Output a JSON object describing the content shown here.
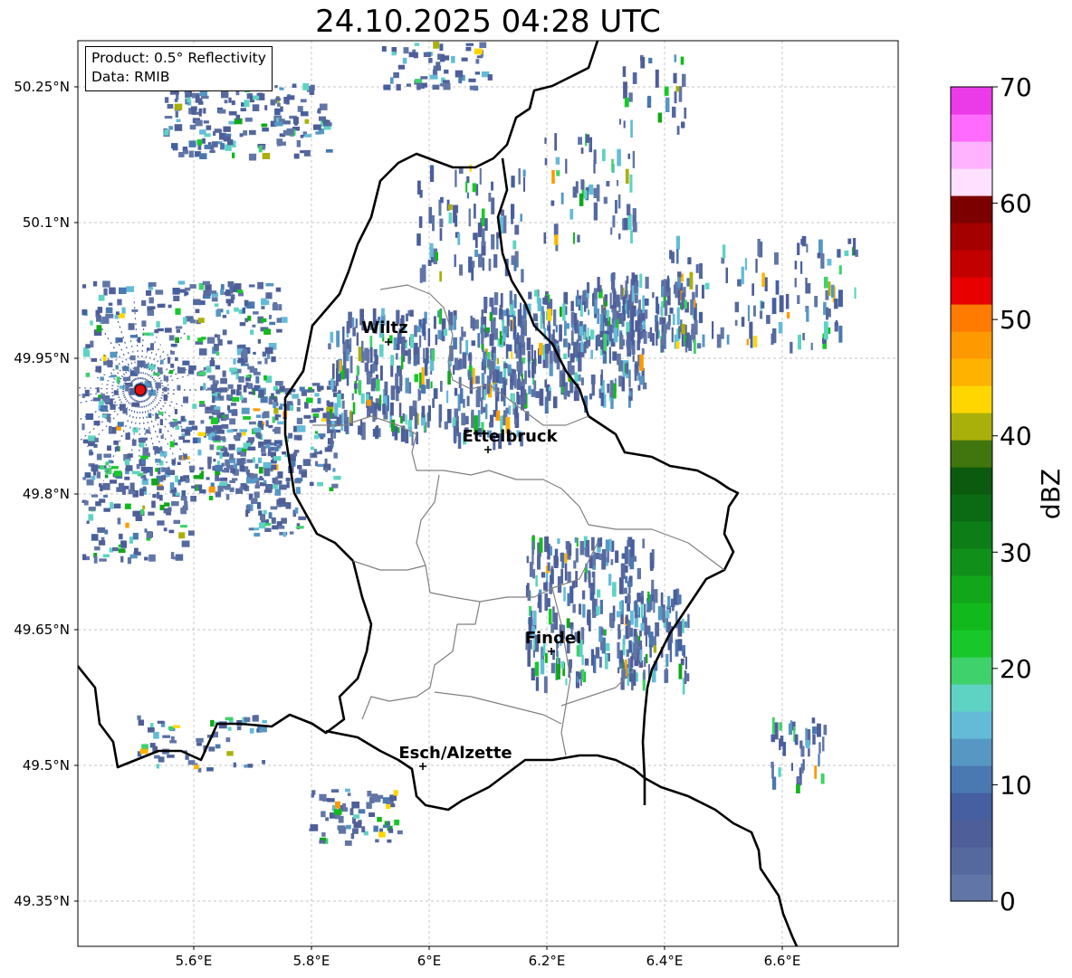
{
  "title": "24.10.2025 04:28 UTC",
  "info": {
    "product": "Product: 0.5° Reflectivity",
    "data": "Data: RMIB"
  },
  "axes": {
    "lon_ticks": [
      "5.6°E",
      "5.8°E",
      "6°E",
      "6.2°E",
      "6.4°E",
      "6.6°E"
    ],
    "lat_ticks": [
      "50.25°N",
      "50.1°N",
      "49.95°N",
      "49.8°N",
      "49.65°N",
      "49.5°N",
      "49.35°N"
    ]
  },
  "cities": [
    {
      "name": "Wiltz"
    },
    {
      "name": "Ettelbruck"
    },
    {
      "name": "Findel"
    },
    {
      "name": "Esch/Alzette"
    }
  ],
  "colorbar": {
    "label": "dBZ",
    "ticks": [
      "0",
      "10",
      "20",
      "30",
      "40",
      "50",
      "60",
      "70"
    ],
    "colors": [
      "#6176a6",
      "#56699f",
      "#4e5e98",
      "#455fa0",
      "#4a78b0",
      "#5797c3",
      "#64bbd8",
      "#5fd3c3",
      "#3fd16b",
      "#18c82a",
      "#12b91c",
      "#12a61a",
      "#10901a",
      "#0d7d18",
      "#0b6a14",
      "#0b5a10",
      "#41760e",
      "#aab00a",
      "#ffd600",
      "#ffb300",
      "#ff9900",
      "#ff7b00",
      "#e60000",
      "#c20000",
      "#a50000",
      "#7d0000",
      "#ffe0ff",
      "#ffb3ff",
      "#ff6bff",
      "#eb3be8"
    ],
    "min": 0,
    "max": 70
  }
}
